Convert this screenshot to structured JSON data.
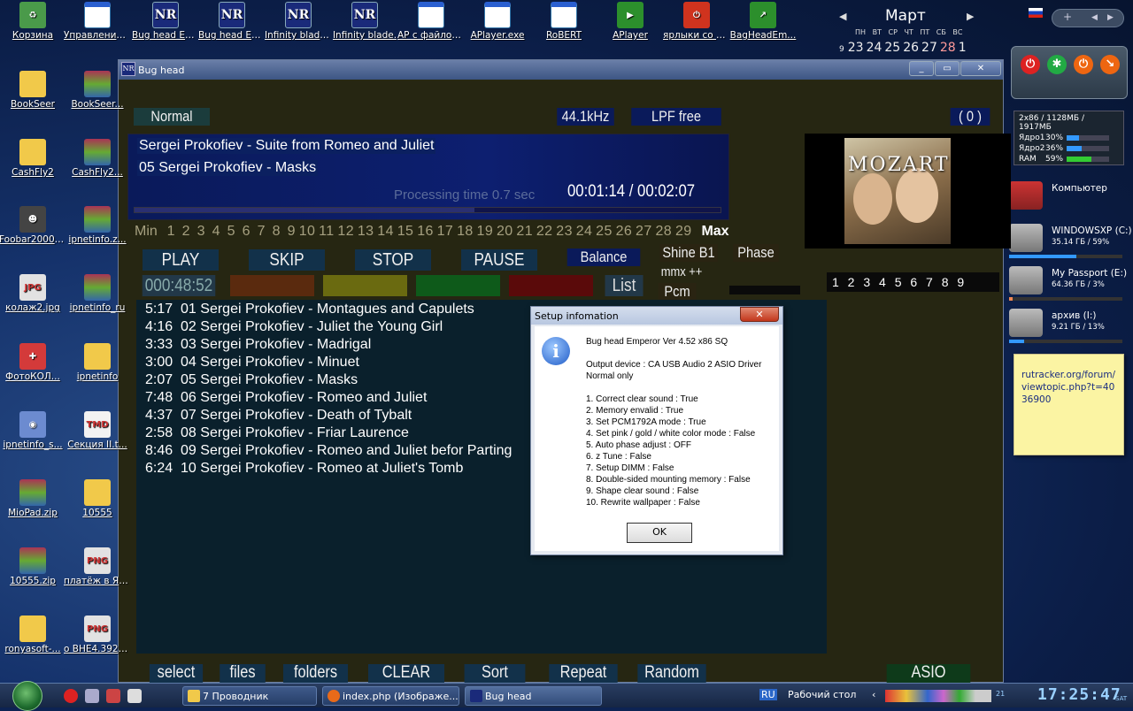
{
  "desktop_icons_left": [
    {
      "label": "Корзина",
      "icon": "recycle-bin-icon"
    },
    {
      "label": "BookSeer",
      "icon": "folder-icon"
    },
    {
      "label": "CashFly2",
      "icon": "folder-icon"
    },
    {
      "label": "Foobar2000 zPack",
      "icon": "alien-icon"
    },
    {
      "label": "колаж2.jpg",
      "icon": "jpg-file-icon"
    },
    {
      "label": "ФотоКОЛ...",
      "icon": "puzzle-icon"
    },
    {
      "label": "ipnetinfo_s...",
      "icon": "installer-icon"
    },
    {
      "label": "MioPad.zip",
      "icon": "winrar-icon"
    },
    {
      "label": "10555.zip",
      "icon": "winrar-icon"
    },
    {
      "label": "ronyasoft-...",
      "icon": "folder-icon"
    }
  ],
  "desktop_icons_col2": [
    {
      "label": "Управление компьютером",
      "icon": "computer-manage-icon"
    },
    {
      "label": "BookSeer...",
      "icon": "winrar-icon"
    },
    {
      "label": "CashFly2...",
      "icon": "winrar-icon"
    },
    {
      "label": "ipnetinfo.z...",
      "icon": "winrar-icon"
    },
    {
      "label": "ipnetinfo_ru",
      "icon": "winrar-icon"
    },
    {
      "label": "ipnetinfo",
      "icon": "folder-icon"
    },
    {
      "label": "Секция II.t...",
      "icon": "tmd-icon"
    },
    {
      "label": "10555",
      "icon": "folder-icon"
    },
    {
      "label": "платёж в ЯндексДе...",
      "icon": "png-file-icon"
    },
    {
      "label": "о ВНЕ4.3920...",
      "icon": "png-file-icon"
    }
  ],
  "desktop_icons_top": [
    {
      "label": "Bug head Emperor SQ.",
      "icon": "nr-icon"
    },
    {
      "label": "Bug head Emperor.",
      "icon": "nr-icon"
    },
    {
      "label": "Infinity blade SQ.",
      "icon": "nr-icon"
    },
    {
      "label": "Infinity blade.",
      "icon": "nr-icon"
    },
    {
      "label": "AP с файлом от ARXETI...",
      "icon": "app-window-icon"
    },
    {
      "label": "APlayer.exe",
      "icon": "app-window-icon"
    },
    {
      "label": "RoBERT",
      "icon": "app-window-icon"
    },
    {
      "label": "APlayer",
      "icon": "play-icon"
    },
    {
      "label": "ярлыки со стола",
      "icon": "power-icon"
    },
    {
      "label": "BagHeadEm...",
      "icon": "green-arrow-icon"
    }
  ],
  "calendar": {
    "month": "Март",
    "day_names": "ПН ВТ СР ЧТ ПТ СБ ВС",
    "week_no": "9",
    "days": [
      "23",
      "24",
      "25",
      "26",
      "27",
      "28",
      "1"
    ]
  },
  "cpu_gadget": {
    "header": "2x86 / 1128МБ / 1917МБ",
    "rows": [
      {
        "name": "Ядро1",
        "value": "30%",
        "fill": 0.3
      },
      {
        "name": "Ядро2",
        "value": "36%",
        "fill": 0.36
      },
      {
        "name": "RAM",
        "value": "59%",
        "fill": 0.59
      }
    ]
  },
  "drives": [
    {
      "name": "Компьютер",
      "size": "",
      "fill": 0
    },
    {
      "name": "WINDOWSXP (C:)",
      "size": "35.14 ГБ / 59%",
      "fill": 0.59
    },
    {
      "name": "My Passport (E:)",
      "size": "64.36 ГБ / 3%",
      "fill": 0.03
    },
    {
      "name": "архив (I:)",
      "size": "9.21 ГБ / 13%",
      "fill": 0.13
    }
  ],
  "sticky_note": "rutracker.org/forum/viewtopic.php?t=4036900",
  "window": {
    "title": "Bug head",
    "title_icon": "NR",
    "mode": "Normal",
    "sample_rate": "44.1kHz",
    "lpf": "LPF free",
    "count": "( 0 )",
    "now_line1": "Sergei Prokofiev - Suite from Romeo and Juliet",
    "now_line2": "05 Sergei Prokofiev - Masks",
    "processing": "Processing time  0.7 sec",
    "time": "00:01:14 / 00:02:07",
    "progress": 0.58,
    "scale_min": "Min",
    "scale_nums": "1  2  3  4  5  6  7  8  9 10 11 12 13 14 15 16 17 18 19 20 21 22 23 24 25 26 27 28 29",
    "scale_max": "Max",
    "buttons": {
      "play": "PLAY",
      "skip": "SKIP",
      "stop": "STOP",
      "pause": "PAUSE",
      "balance": "Balance",
      "shine": "Shine B1",
      "phase": "Phase",
      "mmx": "mmx ++",
      "pcm": "Pcm",
      "list": "List",
      "counter": "000:48:52"
    },
    "album_text": "MOZART",
    "pages": "1 2 3 4 5 6 7 8 9",
    "tracks": [
      {
        "dur": "5:17",
        "title": "01 Sergei Prokofiev - Montagues and Capulets"
      },
      {
        "dur": "4:16",
        "title": "02 Sergei Prokofiev - Juliet the Young Girl"
      },
      {
        "dur": "3:33",
        "title": "03 Sergei Prokofiev - Madrigal"
      },
      {
        "dur": "3:00",
        "title": "04 Sergei Prokofiev - Minuet"
      },
      {
        "dur": "2:07",
        "title": "05 Sergei Prokofiev - Masks"
      },
      {
        "dur": "7:48",
        "title": "06 Sergei Prokofiev - Romeo and Juliet"
      },
      {
        "dur": "4:37",
        "title": "07 Sergei Prokofiev - Death of Tybalt"
      },
      {
        "dur": "2:58",
        "title": "08 Sergei Prokofiev - Friar Laurence"
      },
      {
        "dur": "8:46",
        "title": "09 Sergei Prokofiev - Romeo and Juliet befor Parting"
      },
      {
        "dur": "6:24",
        "title": "10 Sergei Prokofiev - Romeo at Juliet's Tomb"
      }
    ],
    "bottom_buttons": {
      "select": "select",
      "files": "files",
      "folders": "folders",
      "clear": "CLEAR",
      "sort": "Sort",
      "repeat": "Repeat",
      "random": "Random",
      "asio": "ASIO"
    }
  },
  "dialog": {
    "title": "Setup infomation",
    "close": "✕",
    "line_product": "Bug head Emperor   Ver 4.52 x86 SQ",
    "line_device": "Output device : CA USB Audio 2 ASIO Driver",
    "line_normal": "Normal only",
    "settings": [
      "1. Correct clear sound : True",
      "2. Memory envalid : True",
      "3. Set PCM1792A mode : True",
      "4. Set pink / gold / white color mode : False",
      "5. Auto phase adjust : OFF",
      "6. z Tune : False",
      "7. Setup DIMM  : False",
      "8. Double-sided mounting memory : False",
      "9. Shape clear sound : False",
      "10. Rewrite wallpaper : False"
    ],
    "ok": "OK"
  },
  "taskbar": {
    "explorer": "7 Проводник",
    "browser": "index.php (Изображе...",
    "bughead": "Bug head",
    "lang": "RU",
    "desktop": "Рабочий стол",
    "clock": "17:25:47",
    "day": "SAT"
  }
}
